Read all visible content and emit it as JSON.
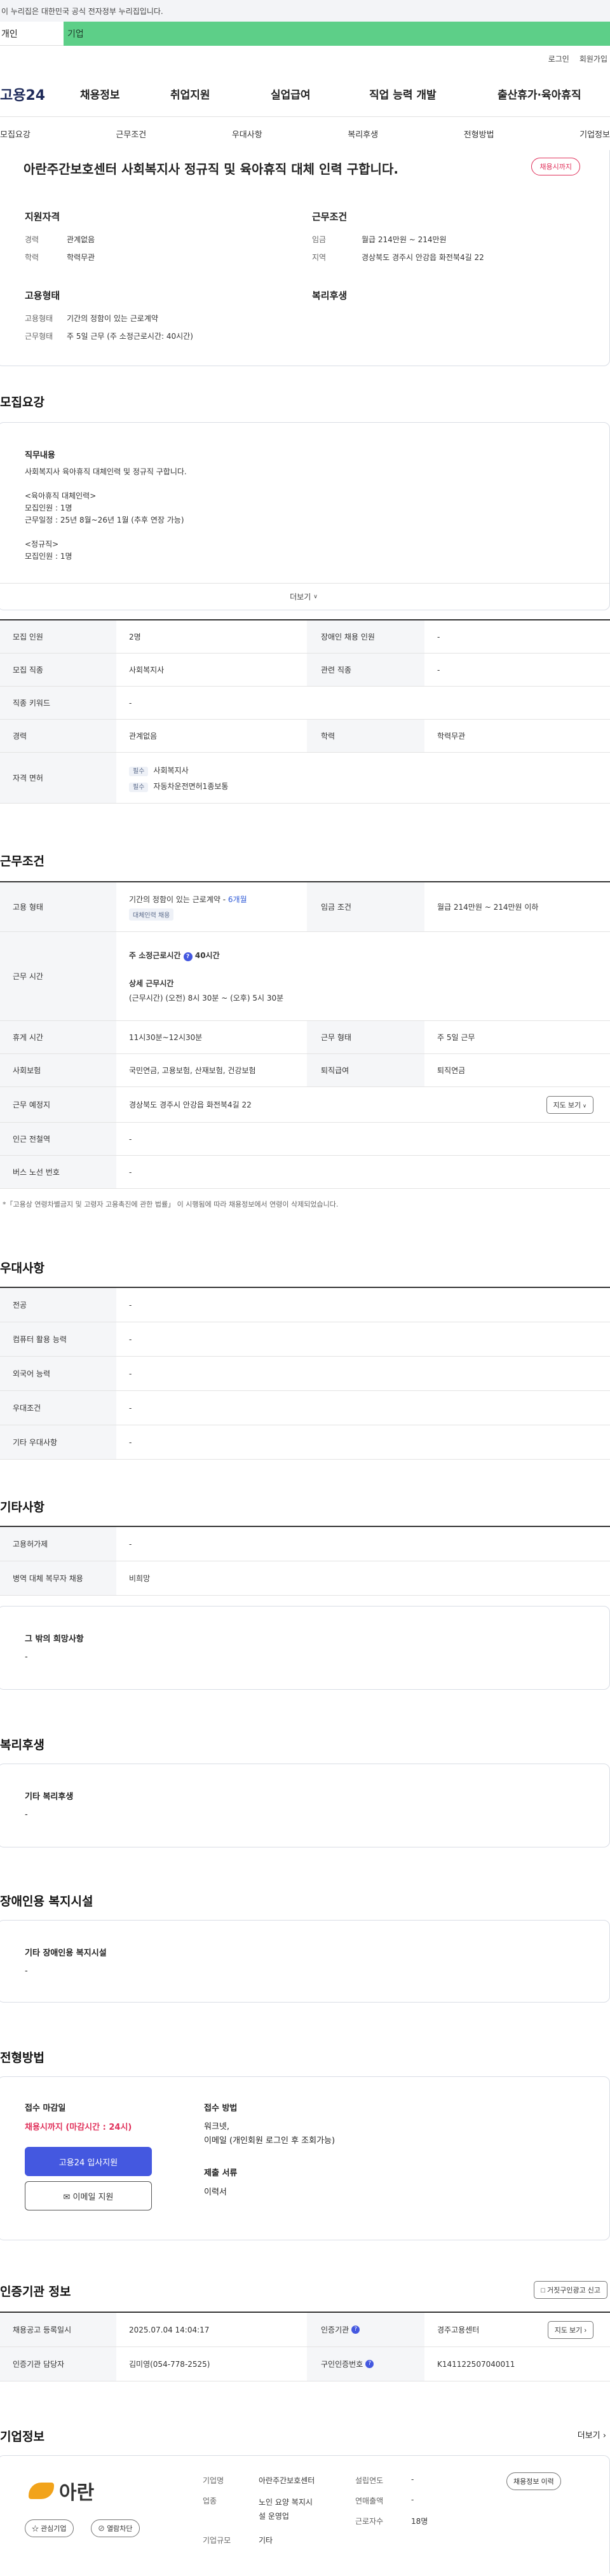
{
  "gov_banner": "이 누리집은 대한민국 공식 전자정부 누리집입니다.",
  "tabs": {
    "personal": "개인",
    "corporate": "기업"
  },
  "util": {
    "login": "로그인",
    "join": "회원가입"
  },
  "logo": "고용24",
  "gnb": [
    "채용정보",
    "취업지원",
    "실업급여",
    "직업 능력 개발",
    "출산휴가·육아휴직"
  ],
  "subtabs": [
    "모집요강",
    "근무조건",
    "우대사항",
    "복리후생",
    "전형방법",
    "기업정보"
  ],
  "job": {
    "title": "아란주간보호센터 사회복지사 정규직 및 육아휴직 대체 인력 구합니다.",
    "badge": "채용시까지",
    "qual_title": "지원자격",
    "exp_k": "경력",
    "exp_v": "관계없음",
    "edu_k": "학력",
    "edu_v": "학력무관",
    "cond_title": "근무조건",
    "wage_k": "임금",
    "wage_v": "월급 214만원 ~ 214만원",
    "area_k": "지역",
    "area_v": "경상북도 경주시 안강읍 화전북4길 22",
    "emp_title": "고용형태",
    "etype_k": "고용형태",
    "etype_v": "기간의 정함이 있는 근로계약",
    "work_k": "근무형태",
    "work_v": "주 5일 근무 (주 소정근로시간: 40시간)",
    "welfare_title": "복리후생"
  },
  "recruit": {
    "title": "모집요강",
    "duty_title": "직무내용",
    "duty_lines": [
      "사회복지사 육아휴직 대체인력 및 정규직 구합니다.",
      "",
      "<육아휴직 대체인력>",
      "모집인원 : 1명",
      "근무일정 : 25년 8월~26년 1월 (추후 연장 가능)",
      "",
      "<정규직>",
      "모집인원 : 1명"
    ],
    "more": "더보기",
    "rows": {
      "count_k": "모집 인원",
      "count_v": "2명",
      "dis_k": "장애인 채용 인원",
      "dis_v": "-",
      "job_k": "모집 직종",
      "job_v": "사회복지사",
      "rel_k": "관련 직종",
      "rel_v": "-",
      "kw_k": "직종 키워드",
      "kw_v": "-",
      "exp_k": "경력",
      "exp_v": "관계없음",
      "edu_k": "학력",
      "edu_v": "학력무관",
      "lic_k": "자격 면허",
      "req": "필수",
      "lic1": "사회복지사",
      "lic2": "자동차운전면허1종보통"
    }
  },
  "conditions": {
    "title": "근무조건",
    "etype_k": "고용 형태",
    "etype_v": "기간의 정함이 있는 근로계약 - ",
    "etype_months": "6개월",
    "etype_badge": "대체인력 채용",
    "wage_k": "임금 조건",
    "wage_v": "월급 214만원 ~ 214만원 이하",
    "hours_k": "근무 시간",
    "hours_main": "주 소정근로시간",
    "hours_val": "40시간",
    "hours_detail_t": "상세 근무시간",
    "hours_detail": "(근무시간) (오전) 8시 30분 ~ (오후) 5시 30분",
    "break_k": "휴게 시간",
    "break_v": "11시30분~12시30분",
    "form_k": "근무 형태",
    "form_v": "주 5일 근무",
    "ins_k": "사회보험",
    "ins_v": "국민연금, 고용보험, 산재보험, 건강보험",
    "ret_k": "퇴직급여",
    "ret_v": "퇴직연금",
    "place_k": "근무 예정지",
    "place_v": "경상북도 경주시 안강읍 화전북4길 22",
    "map": "지도 보기",
    "subway_k": "인근 전철역",
    "subway_v": "-",
    "bus_k": "버스 노선 번호",
    "bus_v": "-",
    "note": "*「고용상 연령차별금지 및 고령자 고용촉진에 관한 법률」 이 시행됨에 따라 채용정보에서 연령이 삭제되었습니다."
  },
  "pref": {
    "title": "우대사항",
    "rows": [
      [
        "전공",
        "-"
      ],
      [
        "컴퓨터 활용 능력",
        "-"
      ],
      [
        "외국어 능력",
        "-"
      ],
      [
        "우대조건",
        "-"
      ],
      [
        "기타 우대사항",
        "-"
      ]
    ]
  },
  "etc": {
    "title": "기타사항",
    "rows": [
      [
        "고용허가제",
        "-"
      ],
      [
        "병역 대체 복무자 채용",
        "비희망"
      ]
    ],
    "hope_t": "그 밖의 희망사항",
    "hope_v": "-"
  },
  "welfare": {
    "title": "복리후생",
    "sub": "기타 복리후생",
    "val": "-"
  },
  "disab": {
    "title": "장애인용 복지시설",
    "sub": "기타 장애인용 복지시설",
    "val": "-"
  },
  "apply": {
    "title": "전형방법",
    "deadline_t": "접수 마감일",
    "deadline_v": "채용시까지 (마감시간 : 24시)",
    "btn_apply": "고용24 입사지원",
    "btn_mail": "이메일 지원",
    "method_t": "접수 방법",
    "method_v1": "워크넷,",
    "method_v2": "이메일 (개인회원 로그인 후 조회가능)",
    "docs_t": "제출 서류",
    "docs_v": "이력서"
  },
  "cert": {
    "title": "인증기관 정보",
    "report": "거짓구인광고 신고",
    "reg_k": "채용공고 등록일시",
    "reg_v": "2025.07.04 14:04:17",
    "org_k": "인증기관",
    "org_v": "경주고용센터",
    "map": "지도 보기",
    "mgr_k": "인증기관 담당자",
    "mgr_v": "김미영(054-778-2525)",
    "no_k": "구인인증번호",
    "no_v": "K141122507040011"
  },
  "company": {
    "title": "기업정보",
    "more": "더보기",
    "logo_text": "아란",
    "fav": "관심기업",
    "block": "열람차단",
    "name_k": "기업명",
    "name_v": "아란주간보호센터",
    "ind_k": "업종",
    "ind_v1": "노인 요양 복지시",
    "ind_v2": "설 운영업",
    "size_k": "기업규모",
    "size_v": "기타",
    "year_k": "설립연도",
    "year_v": "-",
    "sales_k": "연매출액",
    "sales_v": "-",
    "emp_k": "근로자수",
    "emp_v": "18명",
    "hist": "채용정보 이력"
  },
  "colors": {
    "corp_tab": "#5dcf88",
    "accent_red": "#e0315b",
    "primary_blue": "#4458e0"
  }
}
